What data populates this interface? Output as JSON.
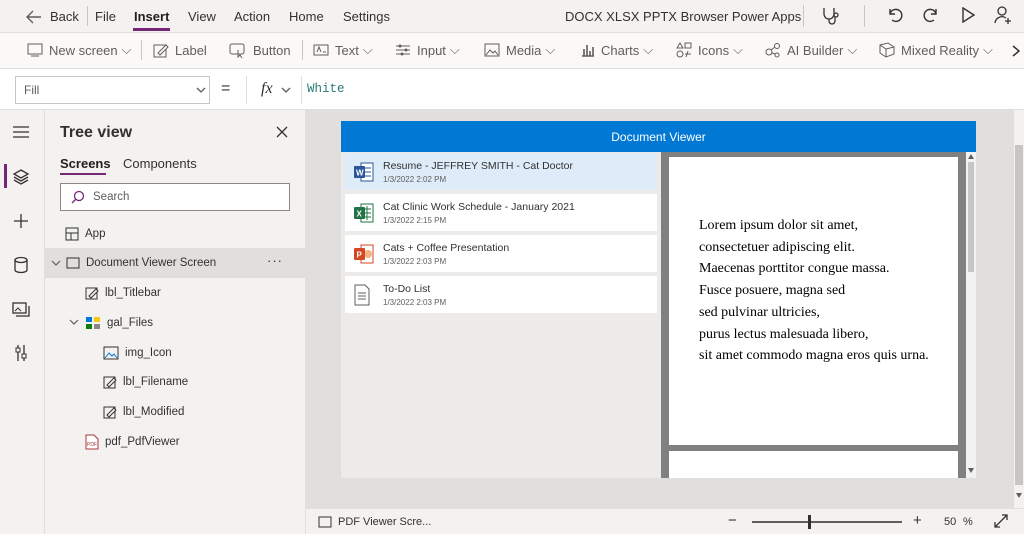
{
  "topbar": {
    "back_label": "Back",
    "menu": [
      "File",
      "Insert",
      "View",
      "Action",
      "Home",
      "Settings"
    ],
    "active_menu": "Insert",
    "app_title": "DOCX XLSX PPTX Browser Power Apps"
  },
  "ribbon": {
    "items": [
      "New screen",
      "Label",
      "Button",
      "Text",
      "Input",
      "Media",
      "Charts",
      "Icons",
      "AI Builder",
      "Mixed Reality"
    ],
    "more_icon": "chevron-right-icon"
  },
  "formula_bar": {
    "property": "Fill",
    "equals": "=",
    "fx": "fx",
    "formula": "White"
  },
  "tree_view": {
    "title": "Tree view",
    "tabs": [
      "Screens",
      "Components"
    ],
    "active_tab": "Screens",
    "search_placeholder": "Search",
    "nodes": [
      {
        "label": "App",
        "icon": "app-icon"
      },
      {
        "label": "Document Viewer Screen",
        "icon": "screen-icon",
        "more": "···"
      },
      {
        "label": "lbl_Titlebar",
        "icon": "label-edit-icon"
      },
      {
        "label": "gal_Files",
        "icon": "gallery-icon"
      },
      {
        "label": "img_Icon",
        "icon": "image-icon"
      },
      {
        "label": "lbl_Filename",
        "icon": "label-edit-icon"
      },
      {
        "label": "lbl_Modified",
        "icon": "label-edit-icon"
      },
      {
        "label": "pdf_PdfViewer",
        "icon": "pdf-icon"
      }
    ]
  },
  "app": {
    "title": "Document Viewer",
    "header_color": "#0078d4",
    "files": [
      {
        "name": "Resume - JEFFREY SMITH - Cat Doctor",
        "modified": "1/3/2022 2:02 PM",
        "icon": "word-icon",
        "selected": true
      },
      {
        "name": "Cat Clinic Work Schedule - January 2021",
        "modified": "1/3/2022 2:15 PM",
        "icon": "excel-icon"
      },
      {
        "name": "Cats + Coffee Presentation",
        "modified": "1/3/2022 2:03 PM",
        "icon": "powerpoint-icon"
      },
      {
        "name": "To-Do List",
        "modified": "1/3/2022 2:03 PM",
        "icon": "document-icon"
      }
    ],
    "pdf_lines": [
      "Lorem ipsum dolor sit amet,",
      "consectetuer adipiscing elit.",
      "Maecenas porttitor congue massa.",
      "Fusce posuere, magna sed",
      "sed pulvinar ultricies,",
      "purus lectus malesuada libero,",
      "sit amet commodo magna eros quis urna."
    ]
  },
  "status": {
    "screen_name": "PDF Viewer Scre...",
    "zoom_value": "50",
    "zoom_unit": "%",
    "zoom_fraction": 0.38
  },
  "colors": {
    "accent": "#742774",
    "brand_blue": "#0078d4",
    "selection": "#deecf9"
  }
}
